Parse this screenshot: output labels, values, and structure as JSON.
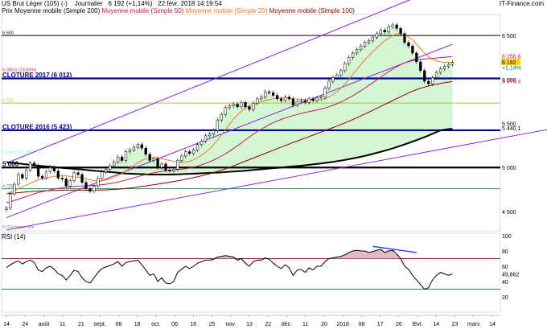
{
  "header": {
    "instrument": "US Brut Léger (105) (-)",
    "period": "Journalier",
    "quote": "6 192 (+1,14%)",
    "datetime": "22 févr. 2018 14:19:54",
    "brand": "IT-Finance.com",
    "legend_price": "Prix",
    "legend_ma200": "Moyenne mobile (Simple 200)",
    "legend_ma50": "Moyenne mobile (Simple 50)",
    "legend_ma20": "Moyenne mobile (Simple 20)",
    "legend_ma100": "Moyenne mobile (Simple 100)",
    "credit": "© IT-Finance.com"
  },
  "colors": {
    "candle": "#000000",
    "ma200": "#000000",
    "ma100": "#8b0000",
    "ma50": "#c2185b",
    "ma20": "#e67e22",
    "channel": "#8a2be2",
    "fill": "#ccf5cc",
    "level_blue": "#00008b",
    "rsi_line": "#000000",
    "rsi_70": "#8b1a6b",
    "rsi_30": "#2e8b57",
    "rsi_fill": "#e0a8b0"
  },
  "chart_data": [
    {
      "type": "candlestick",
      "title": "US Brut Léger (105) (-) Journalier",
      "ylim": [
        4280,
        6720
      ],
      "yticks": [
        4500,
        5000,
        5500,
        6000,
        6500
      ],
      "x_labels": [
        "14",
        "24",
        "août",
        "11",
        "21",
        "sept.",
        "08",
        "18",
        "oct.",
        "06",
        "16",
        "25",
        "nov.",
        "13",
        "22",
        "déc.",
        "11",
        "20",
        "2018",
        "08",
        "17",
        "26",
        "févr.",
        "14",
        "23",
        "mars",
        "14"
      ],
      "levels": [
        {
          "label": "6 500",
          "value": 6500,
          "color": "#000000",
          "style": "solid"
        },
        {
          "label": "6 080,6 (23,60%)",
          "value": 6080.6,
          "color": "#c2185b",
          "style": "label"
        },
        {
          "label": "CLOTURE 2017 (6 012)",
          "value": 6012,
          "color": "#00008b",
          "style": "bold"
        },
        {
          "label": "5 732",
          "value": 5732,
          "color": "#9acd32",
          "style": "solid"
        },
        {
          "label": "CLOTURE 2016 (5 423)",
          "value": 5423,
          "color": "#00008b",
          "style": "bold"
        },
        {
          "label": "5 144,3 (61,80%)",
          "value": 5144.3,
          "color": "#7fffd4",
          "style": "label"
        },
        {
          "label": "5 000",
          "value": 5000,
          "color": "#000000",
          "style": "bold"
        },
        {
          "label": "4 759",
          "value": 4759,
          "color": "#2e8b57",
          "style": "solid"
        }
      ],
      "right_labels": [
        {
          "text": "6 258,6",
          "value": 6258.6,
          "color": "#c2185b"
        },
        {
          "text": "6 192",
          "value": 6192,
          "color": "#000000",
          "bg": "#ffd700"
        },
        {
          "text": "+1,14%",
          "value": 6130,
          "color": "#008000"
        },
        {
          "text": "5 976,4",
          "value": 5976.4,
          "color": "#c2185b"
        },
        {
          "text": "5 440,1",
          "value": 5440.1,
          "color": "#000000"
        }
      ],
      "series": [
        {
          "name": "Prix",
          "type": "candlestick",
          "close": [
            4540,
            4700,
            4810,
            4920,
            4880,
            4970,
            5050,
            5020,
            4900,
            4880,
            4950,
            5000,
            4960,
            4880,
            4870,
            4790,
            4850,
            4940,
            4920,
            4830,
            4760,
            4730,
            4790,
            4880,
            4950,
            4980,
            5020,
            5060,
            5120,
            5080,
            5180,
            5200,
            5230,
            5260,
            5220,
            5150,
            5080,
            5100,
            5000,
            5040,
            4970,
            4960,
            4980,
            5080,
            5130,
            5180,
            5160,
            5200,
            5260,
            5300,
            5360,
            5380,
            5420,
            5540,
            5600,
            5680,
            5700,
            5720,
            5690,
            5740,
            5690,
            5660,
            5730,
            5780,
            5800,
            5860,
            5850,
            5820,
            5780,
            5760,
            5800,
            5780,
            5710,
            5750,
            5760,
            5740,
            5780,
            5760,
            5790,
            5800,
            5900,
            5980,
            6020,
            6050,
            6100,
            6180,
            6250,
            6300,
            6340,
            6380,
            6420,
            6440,
            6480,
            6520,
            6560,
            6540,
            6600,
            6620,
            6580,
            6520,
            6420,
            6380,
            6300,
            6200,
            6100,
            5980,
            5950,
            6020,
            6080,
            6120,
            6150,
            6170,
            6192
          ]
        },
        {
          "name": "Moyenne mobile (Simple 20)",
          "type": "line",
          "values": [
            4700,
            4720,
            4740,
            4760,
            4780,
            4800,
            4820,
            4840,
            4860,
            4870,
            4880,
            4890,
            4900,
            4905,
            4910,
            4905,
            4900,
            4895,
            4890,
            4880,
            4870,
            4860,
            4850,
            4845,
            4850,
            4860,
            4870,
            4890,
            4910,
            4930,
            4960,
            4990,
            5020,
            5050,
            5080,
            5100,
            5110,
            5115,
            5110,
            5100,
            5090,
            5080,
            5070,
            5065,
            5060,
            5060,
            5070,
            5090,
            5110,
            5140,
            5170,
            5210,
            5260,
            5310,
            5370,
            5430,
            5490,
            5550,
            5600,
            5640,
            5680,
            5700,
            5715,
            5730,
            5745,
            5760,
            5770,
            5780,
            5785,
            5790,
            5790,
            5785,
            5780,
            5778,
            5775,
            5772,
            5770,
            5768,
            5768,
            5770,
            5780,
            5800,
            5830,
            5860,
            5900,
            5950,
            6000,
            6060,
            6110,
            6170,
            6220,
            6270,
            6320,
            6360,
            6400,
            6440,
            6470,
            6500,
            6520,
            6520,
            6510,
            6480,
            6450,
            6400,
            6350,
            6300,
            6260,
            6230,
            6210,
            6200,
            6195,
            6193,
            6192
          ]
        },
        {
          "name": "Moyenne mobile (Simple 50)",
          "type": "line",
          "values": [
            4600,
            4610,
            4625,
            4640,
            4655,
            4670,
            4685,
            4700,
            4715,
            4725,
            4735,
            4745,
            4755,
            4762,
            4770,
            4775,
            4780,
            4785,
            4788,
            4790,
            4792,
            4794,
            4796,
            4800,
            4805,
            4810,
            4818,
            4826,
            4836,
            4846,
            4858,
            4870,
            4882,
            4895,
            4908,
            4920,
            4930,
            4940,
            4948,
            4955,
            4962,
            4968,
            4972,
            4976,
            4980,
            4986,
            4994,
            5004,
            5016,
            5030,
            5046,
            5064,
            5084,
            5106,
            5130,
            5156,
            5184,
            5214,
            5246,
            5280,
            5314,
            5346,
            5378,
            5408,
            5436,
            5462,
            5486,
            5508,
            5528,
            5546,
            5562,
            5576,
            5590,
            5602,
            5614,
            5624,
            5634,
            5644,
            5654,
            5664,
            5676,
            5690,
            5706,
            5724,
            5744,
            5766,
            5790,
            5816,
            5844,
            5872,
            5902,
            5932,
            5962,
            5994,
            6026,
            6058,
            6090,
            6118,
            6144,
            6168,
            6188,
            6202,
            6214,
            6222,
            6228,
            6232,
            6236,
            6240,
            6244,
            6248,
            6252,
            6256,
            6258.6
          ]
        },
        {
          "name": "Moyenne mobile (Simple 100)",
          "type": "line",
          "values": [
            4700,
            4705,
            4710,
            4714,
            4718,
            4722,
            4726,
            4729,
            4732,
            4734,
            4736,
            4738,
            4740,
            4741,
            4742,
            4742,
            4742,
            4742,
            4742,
            4742,
            4742,
            4742,
            4742,
            4743,
            4744,
            4746,
            4748,
            4751,
            4754,
            4758,
            4762,
            4767,
            4772,
            4778,
            4784,
            4790,
            4797,
            4804,
            4811,
            4818,
            4825,
            4833,
            4841,
            4849,
            4857,
            4866,
            4875,
            4885,
            4895,
            4906,
            4917,
            4929,
            4942,
            4956,
            4970,
            4985,
            5001,
            5018,
            5035,
            5053,
            5071,
            5089,
            5107,
            5125,
            5143,
            5161,
            5179,
            5197,
            5215,
            5232,
            5249,
            5266,
            5283,
            5300,
            5317,
            5334,
            5351,
            5368,
            5385,
            5402,
            5419,
            5436,
            5453,
            5470,
            5488,
            5506,
            5525,
            5545,
            5565,
            5586,
            5607,
            5628,
            5650,
            5672,
            5694,
            5716,
            5738,
            5760,
            5782,
            5804,
            5826,
            5846,
            5866,
            5884,
            5900,
            5914,
            5926,
            5936,
            5946,
            5954,
            5962,
            5970,
            5976.4
          ]
        },
        {
          "name": "Moyenne mobile (Simple 200)",
          "type": "line",
          "values": [
            5060,
            5055,
            5050,
            5045,
            5040,
            5035,
            5030,
            5025,
            5020,
            5016,
            5012,
            5008,
            5004,
            5000,
            4996,
            4992,
            4988,
            4984,
            4980,
            4976,
            4972,
            4968,
            4964,
            4960,
            4956,
            4952,
            4948,
            4944,
            4940,
            4936,
            4932,
            4930,
            4928,
            4926,
            4924,
            4922,
            4920,
            4920,
            4920,
            4920,
            4920,
            4920,
            4921,
            4922,
            4924,
            4926,
            4928,
            4930,
            4932,
            4934,
            4936,
            4938,
            4940,
            4942,
            4945,
            4948,
            4951,
            4954,
            4957,
            4960,
            4964,
            4968,
            4972,
            4976,
            4980,
            4984,
            4988,
            4992,
            4996,
            5000,
            5004,
            5008,
            5012,
            5016,
            5020,
            5025,
            5030,
            5035,
            5040,
            5046,
            5052,
            5058,
            5064,
            5071,
            5078,
            5086,
            5094,
            5103,
            5112,
            5122,
            5132,
            5143,
            5154,
            5166,
            5178,
            5191,
            5204,
            5218,
            5232,
            5247,
            5262,
            5278,
            5294,
            5311,
            5328,
            5346,
            5364,
            5383,
            5402,
            5421,
            5430,
            5436,
            5440.1
          ]
        }
      ],
      "channels": [
        {
          "name": "canal-haut",
          "from": [
            0,
            5050
          ],
          "to": [
            112,
            7100
          ]
        },
        {
          "name": "canal-bas",
          "from": [
            0,
            4430
          ],
          "to": [
            112,
            6400
          ]
        },
        {
          "name": "tendance-bas",
          "from": [
            0,
            4290
          ],
          "to": [
            150,
            5550
          ]
        }
      ]
    },
    {
      "type": "line",
      "title": "RSI (14)",
      "ylim": [
        0,
        100
      ],
      "yticks": [
        20,
        40,
        60,
        80,
        100
      ],
      "levels": [
        70,
        30
      ],
      "last_label": "49,862",
      "values": [
        58,
        62,
        65,
        67,
        63,
        66,
        68,
        65,
        55,
        53,
        58,
        60,
        56,
        50,
        48,
        42,
        48,
        55,
        53,
        45,
        40,
        38,
        45,
        52,
        57,
        59,
        61,
        63,
        66,
        60,
        65,
        66,
        67,
        68,
        62,
        55,
        48,
        50,
        40,
        45,
        38,
        37,
        40,
        52,
        56,
        60,
        57,
        60,
        64,
        66,
        68,
        68,
        69,
        72,
        73,
        74,
        73,
        72,
        68,
        70,
        64,
        60,
        66,
        68,
        68,
        71,
        69,
        64,
        60,
        57,
        62,
        58,
        48,
        55,
        56,
        52,
        58,
        55,
        60,
        60,
        66,
        70,
        71,
        72,
        73,
        75,
        78,
        80,
        81,
        80,
        80,
        78,
        79,
        81,
        82,
        78,
        80,
        81,
        76,
        70,
        60,
        56,
        48,
        42,
        36,
        30,
        32,
        42,
        48,
        52,
        50,
        48,
        49.862
      ]
    }
  ]
}
